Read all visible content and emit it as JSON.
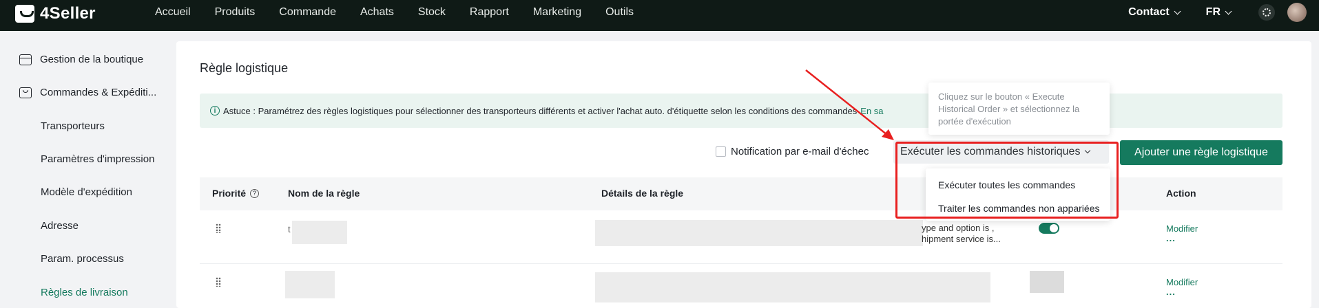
{
  "topbar": {
    "logo_text": "4Seller",
    "nav": [
      "Accueil",
      "Produits",
      "Commande",
      "Achats",
      "Stock",
      "Rapport",
      "Marketing",
      "Outils"
    ],
    "contact_label": "Contact",
    "lang_label": "FR"
  },
  "sidebar": {
    "groups": [
      {
        "label": "Gestion de la boutique",
        "icon": "shop-icon"
      },
      {
        "label": "Commandes & Expéditi...",
        "icon": "bag-icon"
      }
    ],
    "items": [
      {
        "label": "Transporteurs"
      },
      {
        "label": "Paramètres d'impression"
      },
      {
        "label": "Modèle d'expédition"
      },
      {
        "label": "Adresse"
      },
      {
        "label": "Param. processus"
      },
      {
        "label": "Règles de livraison",
        "active": true
      }
    ]
  },
  "main": {
    "title": "Règle logistique",
    "tip_text": "Astuce : Paramétrez des règles logistiques pour sélectionner des transporteurs différents et activer l'achat auto. d'étiquette selon les conditions des commandes",
    "tip_link": "En sa",
    "notification_label": "Notification par e-mail d'échec",
    "execute_button": "Exécuter les commandes historiques",
    "add_button": "Ajouter une règle logistique",
    "tooltip_text": "Cliquez sur le bouton « Execute Historical Order » et sélectionnez la portée d'exécution",
    "dropdown": [
      "Exécuter toutes les commandes",
      "Traiter les commandes non appariées"
    ],
    "table": {
      "columns": [
        "Priorité",
        "Nom de la règle",
        "Détails de la règle",
        "Action"
      ],
      "rows": [
        {
          "name_fragment": "t",
          "details_line1": "ype and option is ,",
          "details_line2": "hipment service is...",
          "action": "Modifier",
          "more": "..."
        },
        {
          "action": "Modifier",
          "more": "..."
        }
      ]
    }
  },
  "colors": {
    "accent": "#157a5e",
    "topbar": "#0f1a16",
    "highlight": "#e81f1f"
  }
}
